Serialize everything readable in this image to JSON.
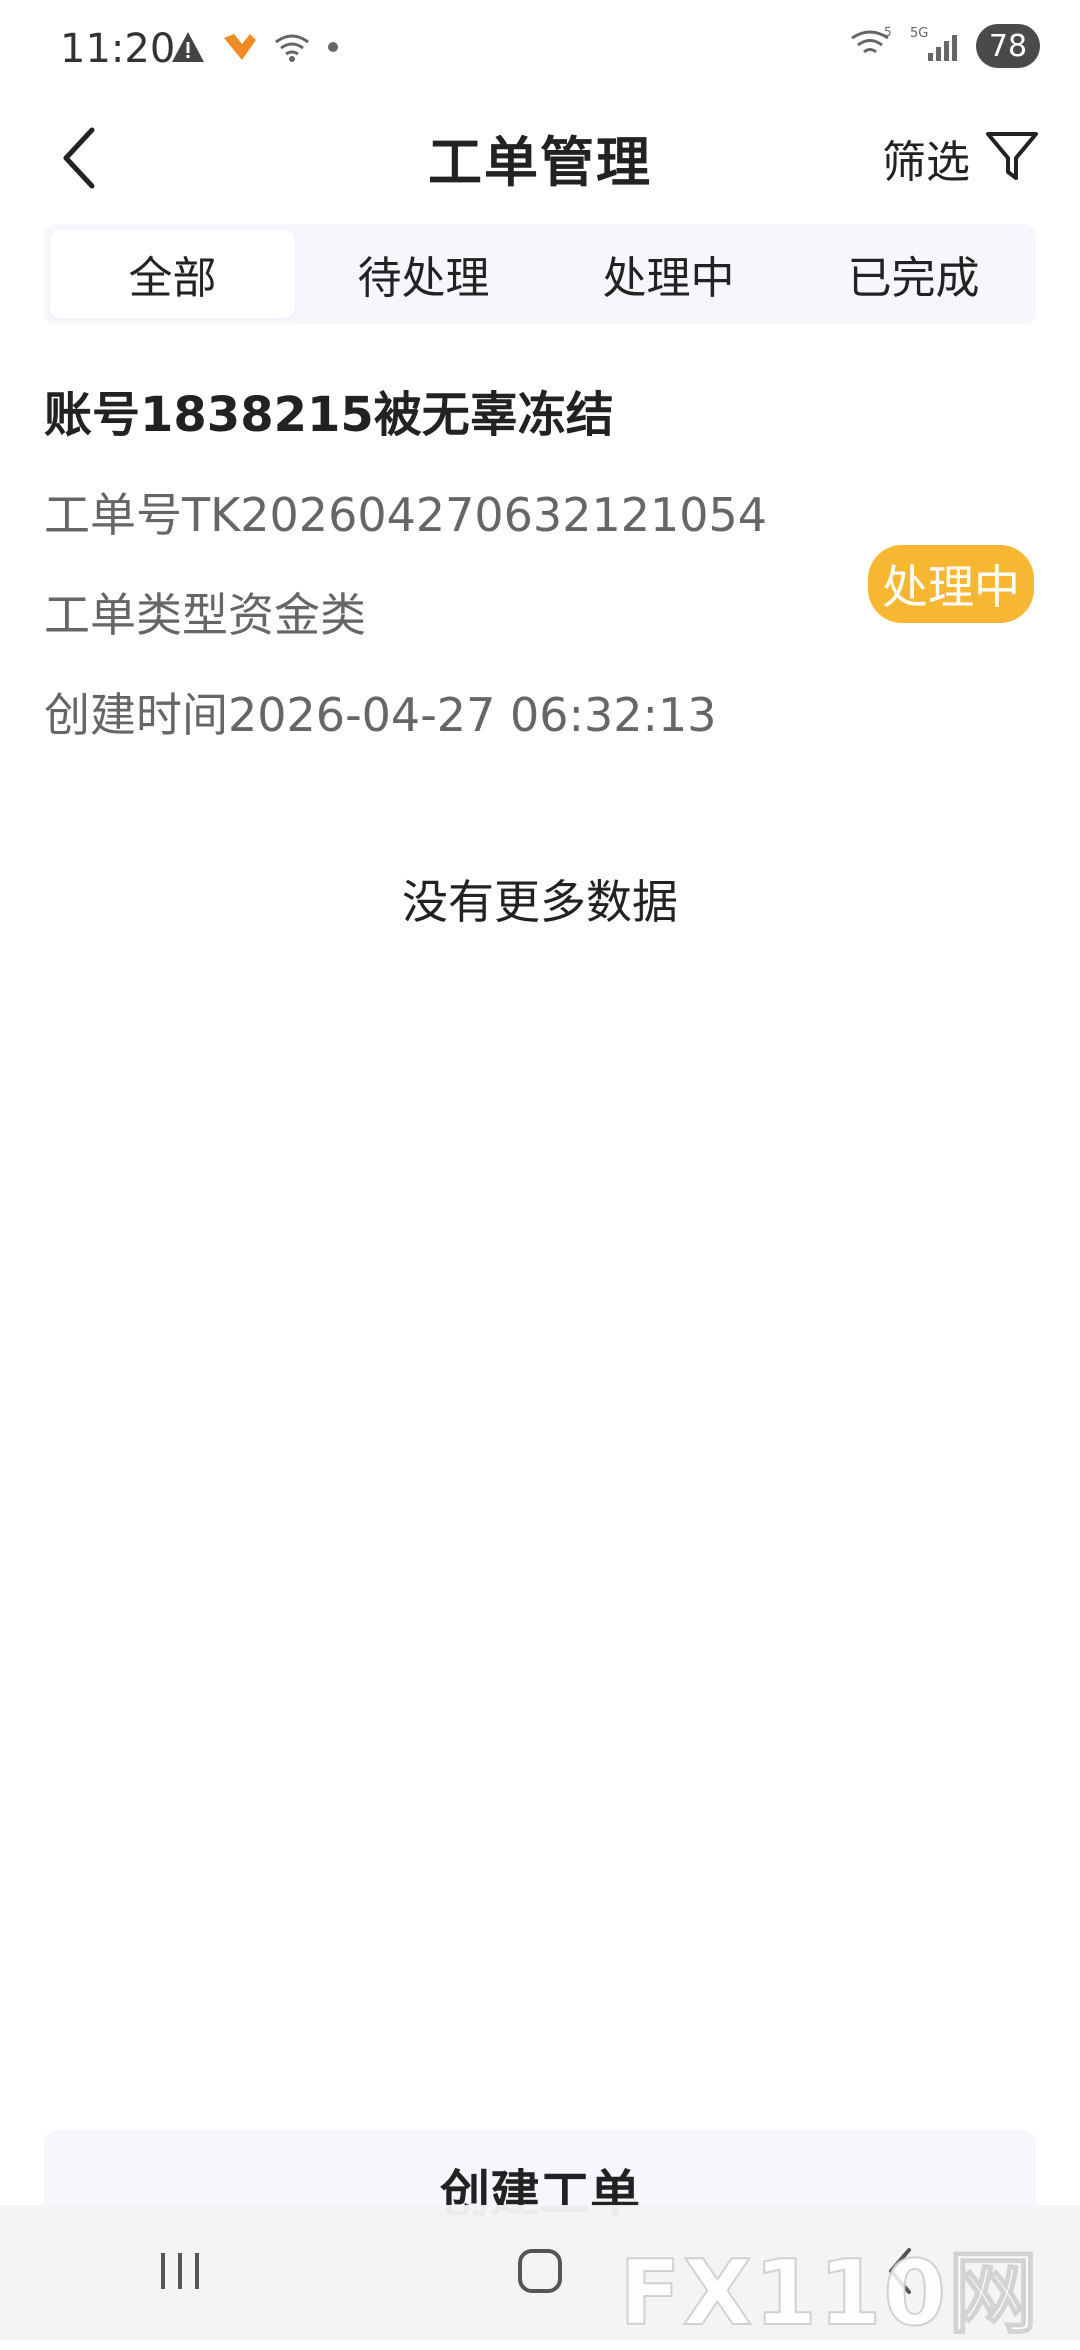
{
  "status_bar": {
    "time": "11:20",
    "battery": "78",
    "network_label": "5G"
  },
  "header": {
    "title": "工单管理",
    "filter_label": "筛选"
  },
  "tabs": [
    {
      "label": "全部",
      "active": true
    },
    {
      "label": "待处理",
      "active": false
    },
    {
      "label": "处理中",
      "active": false
    },
    {
      "label": "已完成",
      "active": false
    }
  ],
  "ticket": {
    "title": "账号1838215被无辜冻结",
    "number": "工单号TK20260427063212​1054",
    "type": "工单类型资金类",
    "created": "创建时间2026-04-27 06:32:13",
    "status": "处理中",
    "status_color": "#f7b733"
  },
  "list_end_text": "没有更多数据",
  "create_button_label": "创建工单",
  "watermark": "FX110网",
  "colors": {
    "accent_yellow": "#f7b733",
    "tab_bg": "#f5f7fd"
  }
}
